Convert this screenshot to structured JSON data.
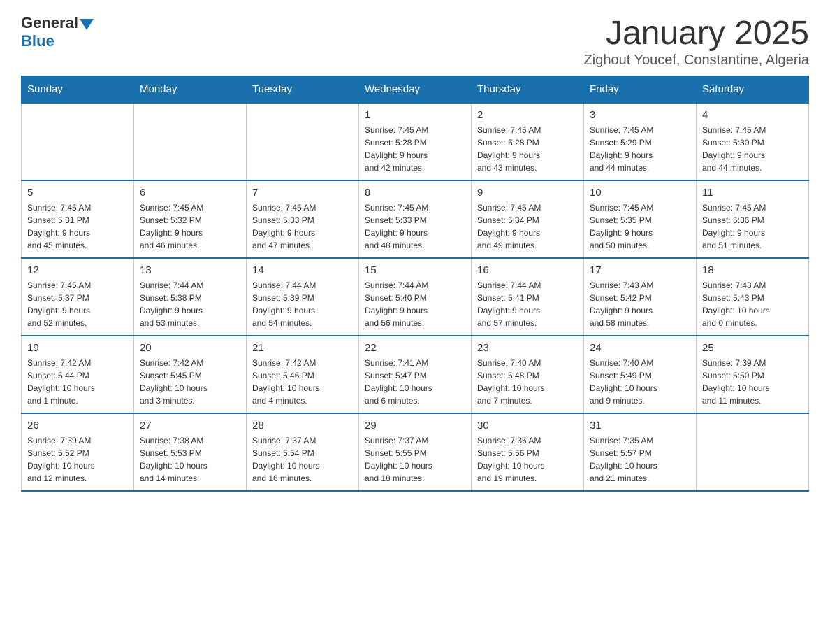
{
  "header": {
    "logo": {
      "line1": "General",
      "triangle": true,
      "line2": "Blue"
    },
    "title": "January 2025",
    "location": "Zighout Youcef, Constantine, Algeria"
  },
  "days_of_week": [
    "Sunday",
    "Monday",
    "Tuesday",
    "Wednesday",
    "Thursday",
    "Friday",
    "Saturday"
  ],
  "weeks": [
    [
      {
        "day": "",
        "info": ""
      },
      {
        "day": "",
        "info": ""
      },
      {
        "day": "",
        "info": ""
      },
      {
        "day": "1",
        "info": "Sunrise: 7:45 AM\nSunset: 5:28 PM\nDaylight: 9 hours\nand 42 minutes."
      },
      {
        "day": "2",
        "info": "Sunrise: 7:45 AM\nSunset: 5:28 PM\nDaylight: 9 hours\nand 43 minutes."
      },
      {
        "day": "3",
        "info": "Sunrise: 7:45 AM\nSunset: 5:29 PM\nDaylight: 9 hours\nand 44 minutes."
      },
      {
        "day": "4",
        "info": "Sunrise: 7:45 AM\nSunset: 5:30 PM\nDaylight: 9 hours\nand 44 minutes."
      }
    ],
    [
      {
        "day": "5",
        "info": "Sunrise: 7:45 AM\nSunset: 5:31 PM\nDaylight: 9 hours\nand 45 minutes."
      },
      {
        "day": "6",
        "info": "Sunrise: 7:45 AM\nSunset: 5:32 PM\nDaylight: 9 hours\nand 46 minutes."
      },
      {
        "day": "7",
        "info": "Sunrise: 7:45 AM\nSunset: 5:33 PM\nDaylight: 9 hours\nand 47 minutes."
      },
      {
        "day": "8",
        "info": "Sunrise: 7:45 AM\nSunset: 5:33 PM\nDaylight: 9 hours\nand 48 minutes."
      },
      {
        "day": "9",
        "info": "Sunrise: 7:45 AM\nSunset: 5:34 PM\nDaylight: 9 hours\nand 49 minutes."
      },
      {
        "day": "10",
        "info": "Sunrise: 7:45 AM\nSunset: 5:35 PM\nDaylight: 9 hours\nand 50 minutes."
      },
      {
        "day": "11",
        "info": "Sunrise: 7:45 AM\nSunset: 5:36 PM\nDaylight: 9 hours\nand 51 minutes."
      }
    ],
    [
      {
        "day": "12",
        "info": "Sunrise: 7:45 AM\nSunset: 5:37 PM\nDaylight: 9 hours\nand 52 minutes."
      },
      {
        "day": "13",
        "info": "Sunrise: 7:44 AM\nSunset: 5:38 PM\nDaylight: 9 hours\nand 53 minutes."
      },
      {
        "day": "14",
        "info": "Sunrise: 7:44 AM\nSunset: 5:39 PM\nDaylight: 9 hours\nand 54 minutes."
      },
      {
        "day": "15",
        "info": "Sunrise: 7:44 AM\nSunset: 5:40 PM\nDaylight: 9 hours\nand 56 minutes."
      },
      {
        "day": "16",
        "info": "Sunrise: 7:44 AM\nSunset: 5:41 PM\nDaylight: 9 hours\nand 57 minutes."
      },
      {
        "day": "17",
        "info": "Sunrise: 7:43 AM\nSunset: 5:42 PM\nDaylight: 9 hours\nand 58 minutes."
      },
      {
        "day": "18",
        "info": "Sunrise: 7:43 AM\nSunset: 5:43 PM\nDaylight: 10 hours\nand 0 minutes."
      }
    ],
    [
      {
        "day": "19",
        "info": "Sunrise: 7:42 AM\nSunset: 5:44 PM\nDaylight: 10 hours\nand 1 minute."
      },
      {
        "day": "20",
        "info": "Sunrise: 7:42 AM\nSunset: 5:45 PM\nDaylight: 10 hours\nand 3 minutes."
      },
      {
        "day": "21",
        "info": "Sunrise: 7:42 AM\nSunset: 5:46 PM\nDaylight: 10 hours\nand 4 minutes."
      },
      {
        "day": "22",
        "info": "Sunrise: 7:41 AM\nSunset: 5:47 PM\nDaylight: 10 hours\nand 6 minutes."
      },
      {
        "day": "23",
        "info": "Sunrise: 7:40 AM\nSunset: 5:48 PM\nDaylight: 10 hours\nand 7 minutes."
      },
      {
        "day": "24",
        "info": "Sunrise: 7:40 AM\nSunset: 5:49 PM\nDaylight: 10 hours\nand 9 minutes."
      },
      {
        "day": "25",
        "info": "Sunrise: 7:39 AM\nSunset: 5:50 PM\nDaylight: 10 hours\nand 11 minutes."
      }
    ],
    [
      {
        "day": "26",
        "info": "Sunrise: 7:39 AM\nSunset: 5:52 PM\nDaylight: 10 hours\nand 12 minutes."
      },
      {
        "day": "27",
        "info": "Sunrise: 7:38 AM\nSunset: 5:53 PM\nDaylight: 10 hours\nand 14 minutes."
      },
      {
        "day": "28",
        "info": "Sunrise: 7:37 AM\nSunset: 5:54 PM\nDaylight: 10 hours\nand 16 minutes."
      },
      {
        "day": "29",
        "info": "Sunrise: 7:37 AM\nSunset: 5:55 PM\nDaylight: 10 hours\nand 18 minutes."
      },
      {
        "day": "30",
        "info": "Sunrise: 7:36 AM\nSunset: 5:56 PM\nDaylight: 10 hours\nand 19 minutes."
      },
      {
        "day": "31",
        "info": "Sunrise: 7:35 AM\nSunset: 5:57 PM\nDaylight: 10 hours\nand 21 minutes."
      },
      {
        "day": "",
        "info": ""
      }
    ]
  ]
}
